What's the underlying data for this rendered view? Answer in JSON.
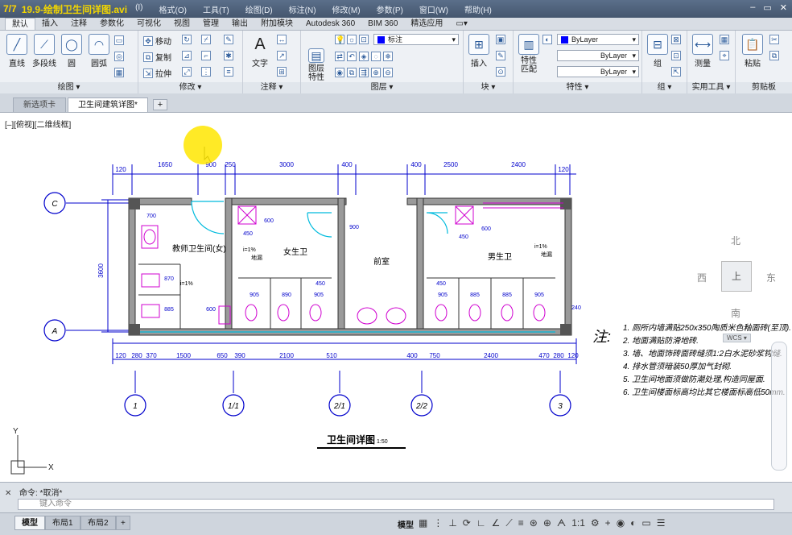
{
  "titlebar": {
    "prefix": "7/7",
    "video_title": "19.9-绘制卫生间详图.avi",
    "menus": [
      "(I)",
      "格式(O)",
      "工具(T)",
      "绘图(D)",
      "标注(N)",
      "修改(M)",
      "参数(P)",
      "窗口(W)",
      "帮助(H)"
    ],
    "min": "–",
    "restore": "▭",
    "close": "✕"
  },
  "ribbon_tabs": [
    "默认",
    "插入",
    "注释",
    "参数化",
    "可视化",
    "视图",
    "管理",
    "输出",
    "附加模块",
    "Autodesk 360",
    "BIM 360",
    "精选应用",
    "▭▾"
  ],
  "ribbon": {
    "draw": {
      "title": "绘图 ▾",
      "tools": [
        "直线",
        "多段线",
        "圆",
        "圆弧"
      ]
    },
    "modify": {
      "title": "修改 ▾",
      "tools": [
        "移动",
        "复制",
        "拉伸"
      ]
    },
    "annotate": {
      "title": "注释 ▾",
      "tool": "文字"
    },
    "layers": {
      "title": "图层 ▾",
      "tool": "图层\n特性",
      "layer_name": "标注"
    },
    "block": {
      "title": "块 ▾",
      "tool": "插入"
    },
    "properties": {
      "title": "特性 ▾",
      "tool": "特性\n匹配",
      "bylayer1": "ByLayer",
      "bylayer2": "ByLayer",
      "bylayer3": "ByLayer"
    },
    "groups": {
      "title": "组 ▾",
      "tool": "组"
    },
    "utilities": {
      "title": "实用工具 ▾",
      "tool": "测量"
    },
    "clipboard": {
      "title": "剪贴板",
      "tool": "粘贴"
    }
  },
  "doc_tabs": {
    "start": "新选项卡",
    "active": "卫生间建筑详图*",
    "add": "+"
  },
  "viewport_label": "[–][俯视][二维线框]",
  "viewcube": {
    "north": "北",
    "south": "南",
    "east": "东",
    "west": "西",
    "face": "上",
    "wcs": "WCS ▾"
  },
  "drawing": {
    "axes_rows": [
      "C",
      "A"
    ],
    "axes_cols": [
      "1",
      "1/1",
      "2/1",
      "2/2",
      "3"
    ],
    "top_dims": [
      "120",
      "1650",
      "900",
      "250",
      "3000",
      "400",
      "400",
      "2500",
      "2400",
      "120"
    ],
    "bottom_dims_row1": [
      "120",
      "280",
      "370",
      "1500",
      "650",
      "390",
      "2100",
      "510",
      "400",
      "750",
      "2400",
      "470",
      "280",
      "120"
    ],
    "left_dim": "3600",
    "rooms": {
      "teacher": "教师卫生间(女)",
      "female": "女生卫",
      "foyer": "前室",
      "male": "男生卫"
    },
    "slope": "i=1%",
    "drain": "地漏",
    "inner_dims": [
      "700",
      "870",
      "885",
      "600",
      "905",
      "890",
      "905",
      "450",
      "450",
      "905",
      "885",
      "885",
      "905",
      "450",
      "600",
      "240",
      "900",
      "450",
      "600"
    ],
    "title": "卫生间详图",
    "scale": "1:50",
    "notes_label": "注:",
    "notes": [
      "1. 厕所内墙满贴250x350陶质米色釉面砖(至顶).",
      "2. 地面满贴防滑地砖.",
      "3. 墙、地面饰砖面砖缝须1:2白水泥砂浆钩缝.",
      "4. 排水管须暗装50厚加气封砌.",
      "5. 卫生间地面须做防潮处理,构造同屋面.",
      "6. 卫生间楼面标高均比其它楼面标高低50mm."
    ],
    "ucs_y": "Y",
    "ucs_x": "X"
  },
  "command": {
    "history": "命令: *取消*",
    "placeholder": "键入命令",
    "close": "✕"
  },
  "status": {
    "model_tab": "模型",
    "layout1": "布局1",
    "layout2": "布局2",
    "add": "+",
    "model_lbl": "模型",
    "scale": "1:1"
  },
  "colors": {
    "wall": "#555555",
    "dim": "#0000cc",
    "door": "#00bbdd",
    "fixture": "#d000d0",
    "text": "#000000",
    "axis": "#0000cc"
  }
}
